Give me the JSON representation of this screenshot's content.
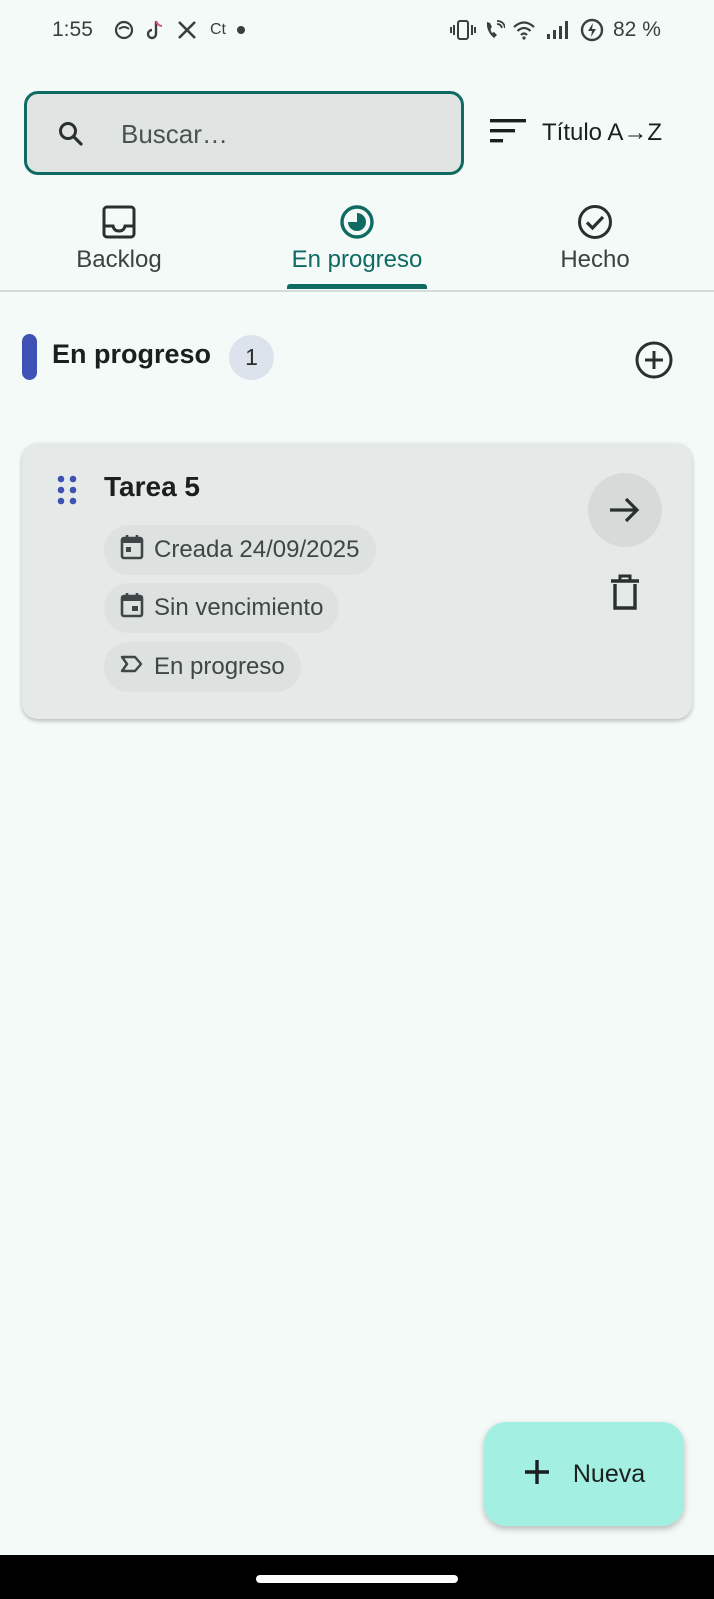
{
  "status_bar": {
    "time": "1:55",
    "battery": "82 %",
    "icons": [
      "chat-bubble-icon",
      "tiktok-icon",
      "x-icon",
      "ct-icon",
      "notification-dot-icon",
      "vibrate-icon",
      "wifi-call-icon",
      "wifi-icon",
      "signal-icon",
      "battery-charging-icon"
    ]
  },
  "search": {
    "placeholder": "Buscar…",
    "value": ""
  },
  "sort": {
    "label": "Título A→Z",
    "icon": "sort-icon"
  },
  "tabs": [
    {
      "label": "Backlog",
      "icon": "inbox-icon",
      "active": false
    },
    {
      "label": "En progreso",
      "icon": "progress-icon",
      "active": true
    },
    {
      "label": "Hecho",
      "icon": "check-circle-icon",
      "active": false
    }
  ],
  "section": {
    "title": "En progreso",
    "count": "1",
    "accent": "#3f51b5"
  },
  "cards": [
    {
      "title": "Tarea 5",
      "created": "Creada 24/09/2025",
      "due": "Sin vencimiento",
      "status": "En progreso"
    }
  ],
  "fab": {
    "label": "Nueva"
  },
  "colors": {
    "primary": "#0f6b62",
    "background": "#f4faf8",
    "fab": "#a3efe2"
  }
}
